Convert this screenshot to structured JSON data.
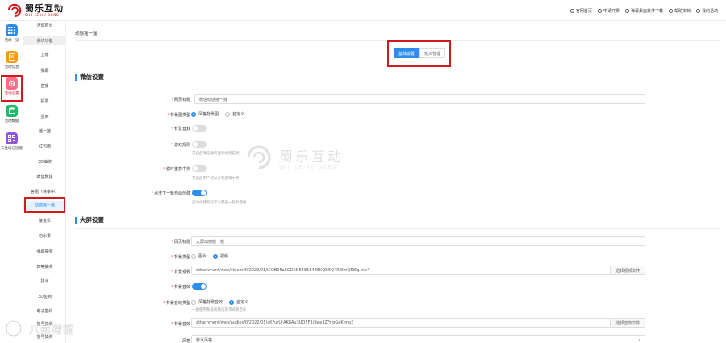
{
  "brand": {
    "name_cn": "蜀乐互动",
    "name_en": "SHU LE HU DONG",
    "accent": "#d0191f"
  },
  "topnav": [
    {
      "label": "官网首页",
      "icon": "home-icon"
    },
    {
      "label": "申请开票",
      "icon": "invoice-icon"
    },
    {
      "label": "弹幕桌面软件下载",
      "icon": "download-icon"
    },
    {
      "label": "帮助文档",
      "icon": "help-icon"
    },
    {
      "label": "我的活动",
      "icon": "user-icon"
    }
  ],
  "rail": [
    {
      "label": "活动一览",
      "icon": "grid-icon",
      "color": "#2d8cf0"
    },
    {
      "label": "活动信息",
      "icon": "document-icon",
      "color": "#ff9900"
    },
    {
      "label": "活动设置",
      "icon": "gear-icon",
      "color": "#ff6b8a"
    },
    {
      "label": "活动数据",
      "icon": "database-icon",
      "color": "#19be6b"
    },
    {
      "label": "二维码与链接",
      "icon": "qrcode-icon",
      "color": "#9254de"
    }
  ],
  "submenu": {
    "items": [
      "活动首页",
      "系统功能",
      "上墙",
      "弹幕",
      "直播",
      "投票",
      "签到",
      "摇一摇",
      "红包雨",
      "3D抽奖",
      "疯狂数钱",
      "答题（待审中）",
      "动感摇一摇",
      "接金币",
      "切水果",
      "弹幕抽奖",
      "四等抽奖",
      "拔河",
      "3D签到",
      "电子签约",
      "摇号抽奖",
      "摇号抽奖"
    ]
  },
  "main": {
    "breadcrumb": "动感摇一摇",
    "tabs": [
      "基础设置",
      "轮次管理"
    ],
    "wechat_section": {
      "title": "微信设置",
      "page_title_label": "网页标题",
      "page_title_value": "微信动感摇一摇",
      "bg_type_label": "背景图类型",
      "bg_type_options": [
        "风格背景图",
        "自定义"
      ],
      "bg_music_label": "背景音效",
      "game_rule_label": "游戏规则",
      "game_rule_hint": "开启后微信端将显示规则说明",
      "allow_repeat_label": "循环重复中奖",
      "allow_repeat_hint": "开启后用户可以多轮游戏中奖",
      "auto_next_label": "点击下一轮自动创建",
      "auto_next_hint": "自动创建的轮次以最后一轮为模板"
    },
    "screen_section": {
      "title": "大屏设置",
      "page_title_label": "网页标题",
      "page_title_value": "大屏动感摇一摇",
      "bg_type_label": "背景类型",
      "bg_type_options": [
        "图片",
        "视频"
      ],
      "bg_video_label": "背景视频",
      "bg_video_value": "attachment/web/videos/0/2022/01/lCOB06oSGDSD64858486KQN5Q4RWmQ5I6q.mp4",
      "bg_video_button": "选择视频文件",
      "bg_music_label": "背景音效",
      "bg_music_type_label": "背景音效类型",
      "bg_music_type_options": [
        "风格背景音效",
        "自定义"
      ],
      "bg_music_type_hint": "一般使用系统风格内容带背景音乐",
      "bg_music_file_label": "背景音效",
      "bg_music_file_value": "attachment/web/audios/0/2022/05/oKFurUrAK8Au3UQ5F3i3we3ZFrfgGeK.mp3",
      "bg_music_file_button": "选择音效文件",
      "style_label": "风格",
      "style_value": "默认风格"
    }
  },
  "watermark": {
    "cn": "蜀乐互动",
    "en": "SHU LE HU DONG"
  },
  "corner_watermark": "八戒猪镜",
  "colors": {
    "primary": "#2d8cf0",
    "highlight": "#d0191f"
  }
}
